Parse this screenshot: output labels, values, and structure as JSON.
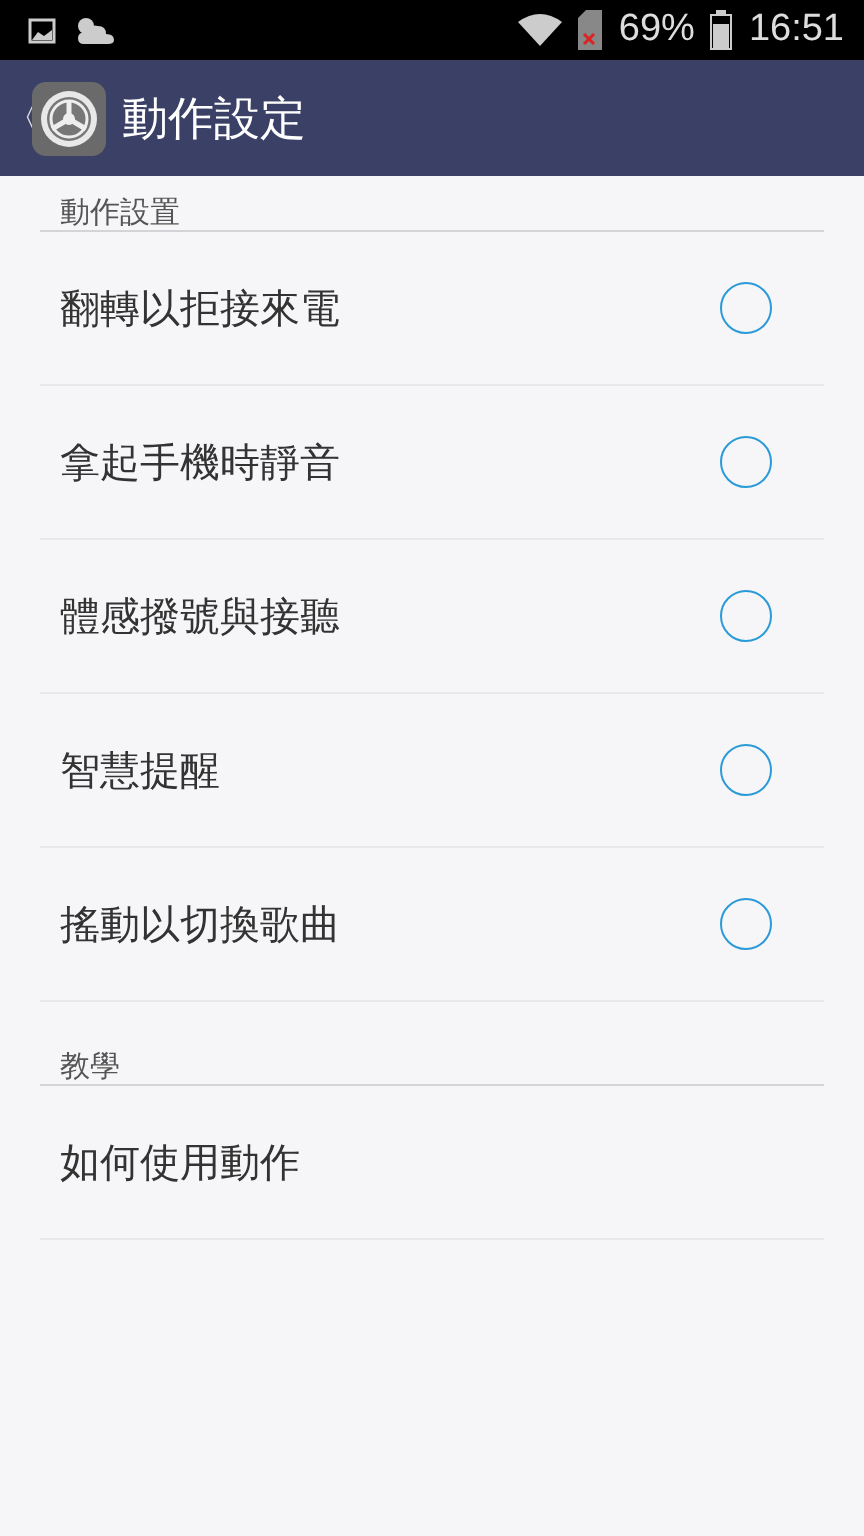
{
  "status_bar": {
    "battery_percent": "69%",
    "time": "16:51"
  },
  "app_bar": {
    "back": "〈",
    "title": "動作設定"
  },
  "sections": [
    {
      "header": "動作設置",
      "items": [
        {
          "kind": "toggle",
          "label": "翻轉以拒接來電",
          "checked": false
        },
        {
          "kind": "toggle",
          "label": "拿起手機時靜音",
          "checked": false
        },
        {
          "kind": "toggle",
          "label": "體感撥號與接聽",
          "checked": false
        },
        {
          "kind": "toggle",
          "label": "智慧提醒",
          "checked": false
        },
        {
          "kind": "toggle",
          "label": "搖動以切換歌曲",
          "checked": false
        }
      ]
    },
    {
      "header": "教學",
      "items": [
        {
          "kind": "link",
          "label": "如何使用動作"
        }
      ]
    }
  ]
}
